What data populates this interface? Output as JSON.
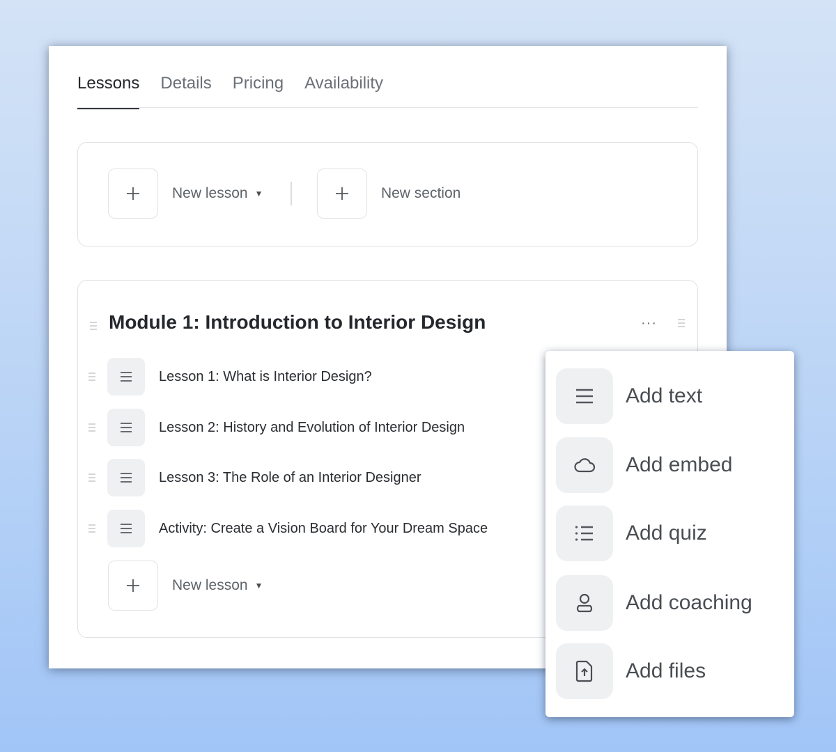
{
  "tabs": [
    {
      "label": "Lessons",
      "active": true
    },
    {
      "label": "Details",
      "active": false
    },
    {
      "label": "Pricing",
      "active": false
    },
    {
      "label": "Availability",
      "active": false
    }
  ],
  "toolbar": {
    "new_lesson_label": "New lesson",
    "new_section_label": "New section",
    "plus_icon": "plus-icon",
    "caret_icon": "caret-down-icon"
  },
  "module": {
    "title": "Module 1: Introduction to Interior Design",
    "more_label": "···",
    "lessons": [
      {
        "title": "Lesson 1: What is Interior Design?",
        "icon": "text-lines-icon"
      },
      {
        "title": "Lesson 2: History and Evolution of Interior Design",
        "icon": "text-lines-icon"
      },
      {
        "title": "Lesson 3: The Role of an Interior Designer",
        "icon": "text-lines-icon"
      },
      {
        "title": "Activity: Create a Vision Board for Your Dream Space",
        "icon": "text-lines-icon"
      }
    ],
    "new_lesson_label": "New lesson"
  },
  "add_menu": {
    "items": [
      {
        "label": "Add text",
        "icon": "text-lines-icon"
      },
      {
        "label": "Add embed",
        "icon": "cloud-icon"
      },
      {
        "label": "Add quiz",
        "icon": "list-icon"
      },
      {
        "label": "Add coaching",
        "icon": "person-icon"
      },
      {
        "label": "Add files",
        "icon": "file-upload-icon"
      }
    ]
  }
}
